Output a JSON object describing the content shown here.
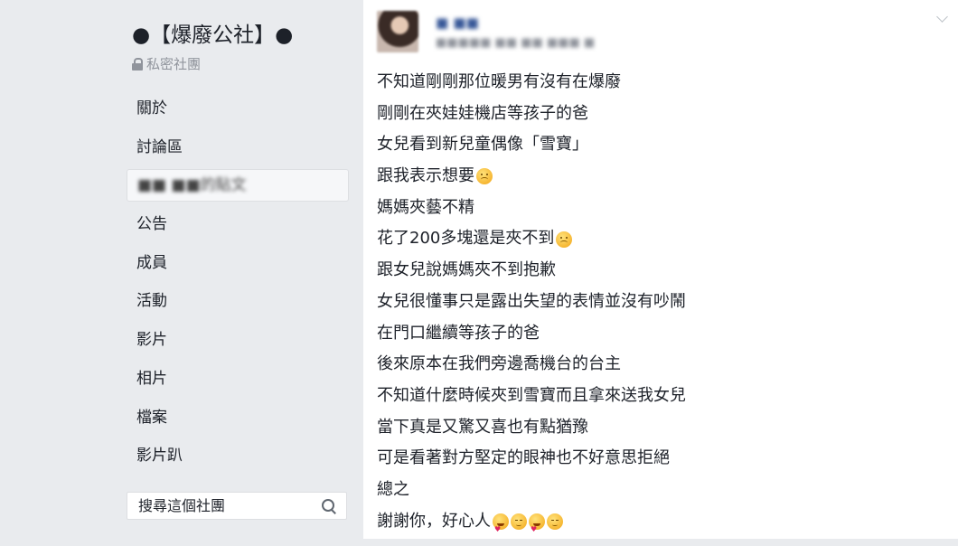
{
  "group": {
    "name": "●【爆廢公社】●",
    "type": "私密社團"
  },
  "nav": {
    "items": [
      {
        "label": "關於",
        "active": false
      },
      {
        "label": "討論區",
        "active": false
      },
      {
        "label": "■■ ■■的貼文",
        "active": true
      },
      {
        "label": "公告",
        "active": false
      },
      {
        "label": "成員",
        "active": false
      },
      {
        "label": "活動",
        "active": false
      },
      {
        "label": "影片",
        "active": false
      },
      {
        "label": "相片",
        "active": false
      },
      {
        "label": "檔案",
        "active": false
      },
      {
        "label": "影片趴",
        "active": false
      }
    ]
  },
  "search": {
    "placeholder": "搜尋這個社團",
    "icon": "search-icon"
  },
  "post": {
    "author": "■ ■■",
    "meta": "■■■■■ ■■ ■■ ■■■ ■",
    "lines": [
      {
        "text": "不知道剛剛那位暖男有沒有在爆廢",
        "emoji": []
      },
      {
        "text": "剛剛在夾娃娃機店等孩子的爸",
        "emoji": []
      },
      {
        "text": "女兒看到新兒童偶像「雪寶」",
        "emoji": []
      },
      {
        "text": "跟我表示想要",
        "emoji": [
          "sad"
        ]
      },
      {
        "text": "媽媽夾藝不精",
        "emoji": []
      },
      {
        "text": "花了200多塊還是夾不到",
        "emoji": [
          "sad"
        ]
      },
      {
        "text": "跟女兒說媽媽夾不到抱歉",
        "emoji": []
      },
      {
        "text": "女兒很懂事只是露出失望的表情並沒有吵鬧",
        "emoji": []
      },
      {
        "text": "在門口繼續等孩子的爸",
        "emoji": []
      },
      {
        "text": "後來原本在我們旁邊喬機台的台主",
        "emoji": []
      },
      {
        "text": "不知道什麼時候夾到雪寶而且拿來送我女兒",
        "emoji": []
      },
      {
        "text": "當下真是又驚又喜也有點猶豫",
        "emoji": []
      },
      {
        "text": "可是看著對方堅定的眼神也不好意思拒絕",
        "emoji": []
      },
      {
        "text": "總之",
        "emoji": []
      },
      {
        "text": "謝謝你，好心人",
        "emoji": [
          "heart-eyes",
          "blush",
          "heart-eyes",
          "blush"
        ]
      }
    ]
  },
  "colors": {
    "sidebar_bg": "#e9ebee",
    "post_bg": "#ffffff",
    "text": "#1d2129",
    "muted": "#90949c",
    "link": "#385898"
  }
}
